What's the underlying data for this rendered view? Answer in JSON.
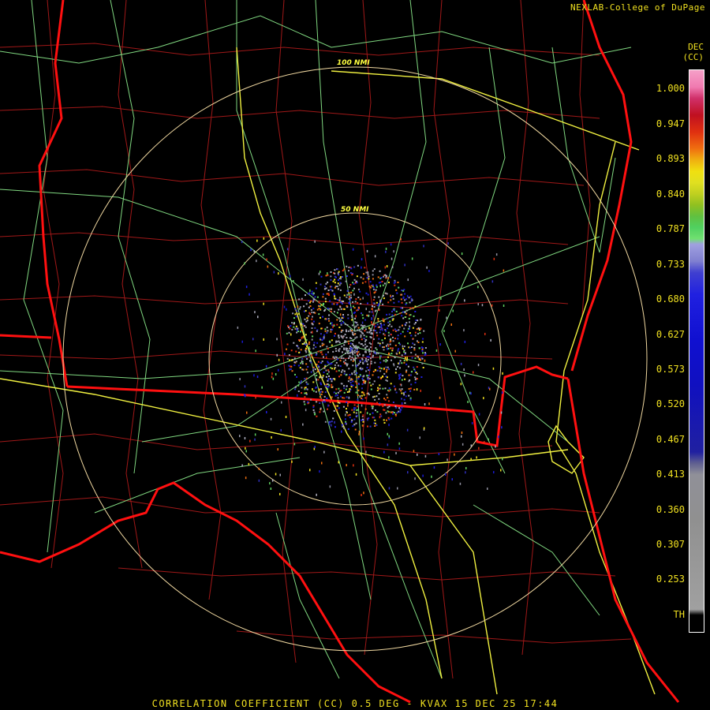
{
  "credit": "NEXLAB-College of DuPage",
  "units_top": "DEC",
  "units_bottom": "(CC)",
  "legend": {
    "labels": [
      "1.000",
      "0.947",
      "0.893",
      "0.840",
      "0.787",
      "0.733",
      "0.680",
      "0.627",
      "0.573",
      "0.520",
      "0.467",
      "0.413",
      "0.360",
      "0.307",
      "0.253",
      "TH"
    ]
  },
  "range_rings": [
    {
      "label": "50 NMI"
    },
    {
      "label": "100 NMI"
    }
  ],
  "footer": "CORRELATION COEFFICIENT (CC) 0.5 DEG - KVAX 15 DEC 25 17:44",
  "colors": {
    "state_border": "#ff1010",
    "county_border": "#b01818",
    "highway": "#f0f040",
    "road": "#90e090",
    "ring": "#f0d8a0",
    "text": "#f0e020"
  }
}
